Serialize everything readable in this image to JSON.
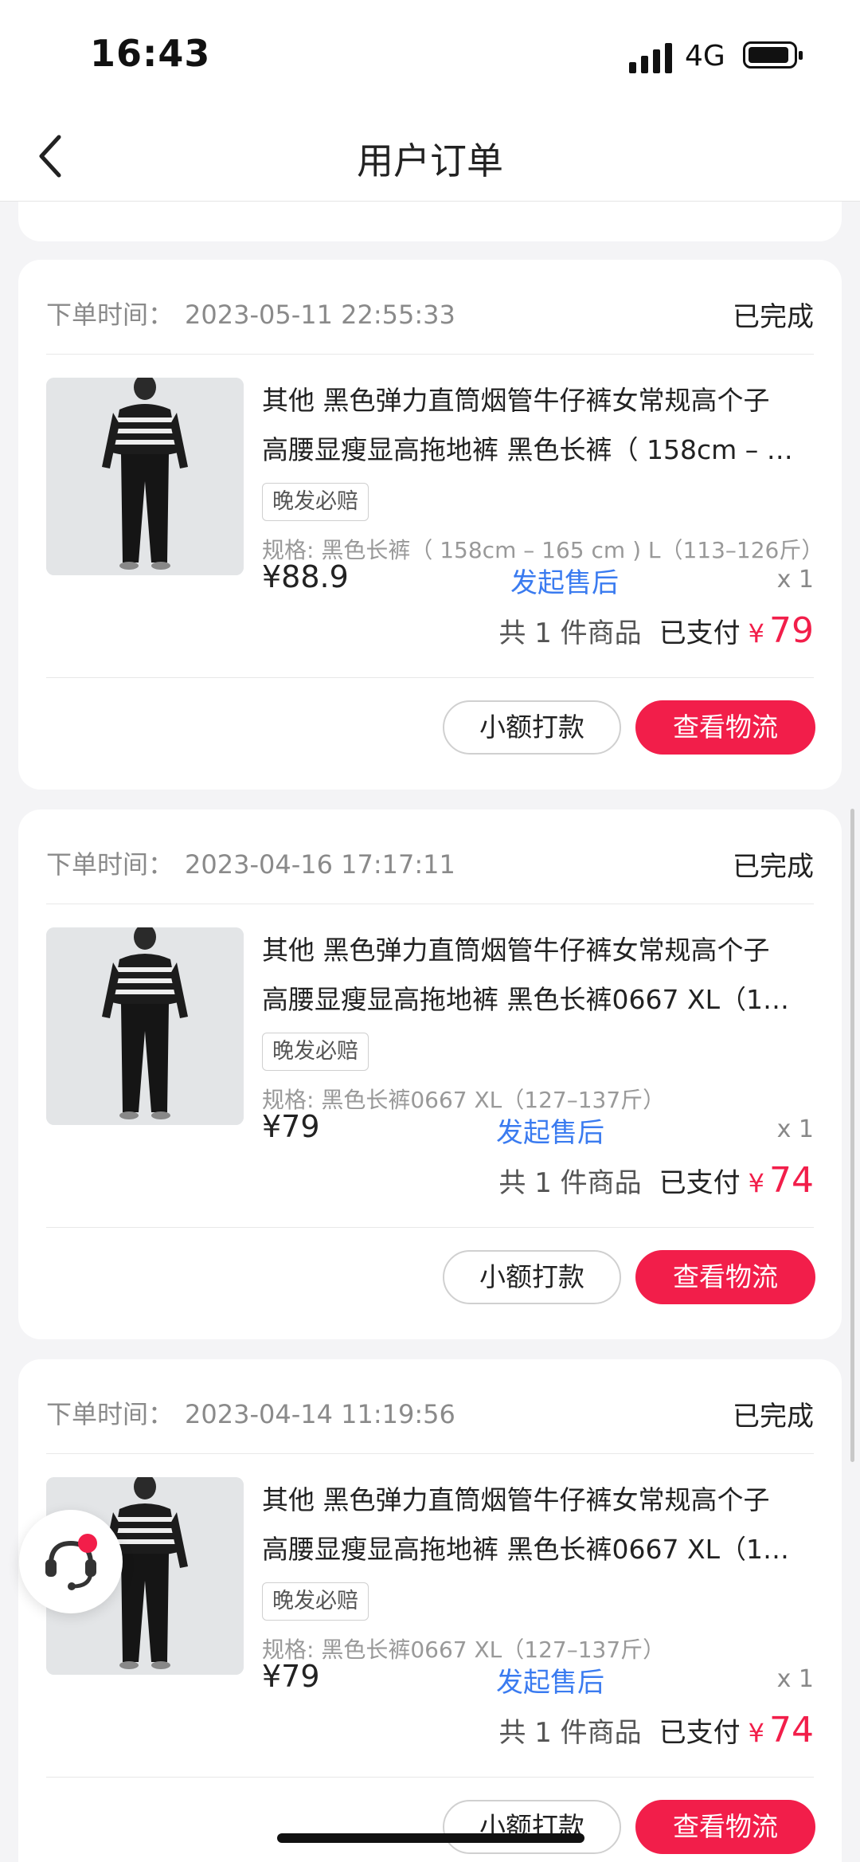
{
  "status_bar": {
    "time": "16:43",
    "network": "4G"
  },
  "nav": {
    "title": "用户订单"
  },
  "labels": {
    "order_time": "下单时间：",
    "badge": "晚发必赔",
    "after_sale": "发起售后",
    "total_prefix": "共 1 件商品",
    "paid": "已支付",
    "currency": "¥",
    "small_payment": "小额打款",
    "view_logistics": "查看物流"
  },
  "orders": [
    {
      "time": "2023-05-11 22:55:33",
      "status": "已完成",
      "title_line1": "其他 黑色弹力直筒烟管牛仔裤女常规高个子",
      "title_line2": "高腰显瘦显高拖地裤 黑色长裤（ 158cm – …",
      "spec": "规格: 黑色长裤（ 158cm – 165 cm ) L（113–126斤）",
      "price": "¥88.9",
      "qty": "x 1",
      "paid_amount": "79"
    },
    {
      "time": "2023-04-16 17:17:11",
      "status": "已完成",
      "title_line1": "其他 黑色弹力直筒烟管牛仔裤女常规高个子",
      "title_line2": "高腰显瘦显高拖地裤 黑色长裤0667 XL（1…",
      "spec": "规格: 黑色长裤0667 XL（127–137斤）",
      "price": "¥79",
      "qty": "x 1",
      "paid_amount": "74"
    },
    {
      "time": "2023-04-14 11:19:56",
      "status": "已完成",
      "title_line1": "其他 黑色弹力直筒烟管牛仔裤女常规高个子",
      "title_line2": "高腰显瘦显高拖地裤 黑色长裤0667 XL（1…",
      "spec": "规格: 黑色长裤0667 XL（127–137斤）",
      "price": "¥79",
      "qty": "x 1",
      "paid_amount": "74"
    }
  ],
  "colors": {
    "accent": "#f21e4a",
    "link": "#3a7bf0",
    "background": "#f4f4f6"
  }
}
